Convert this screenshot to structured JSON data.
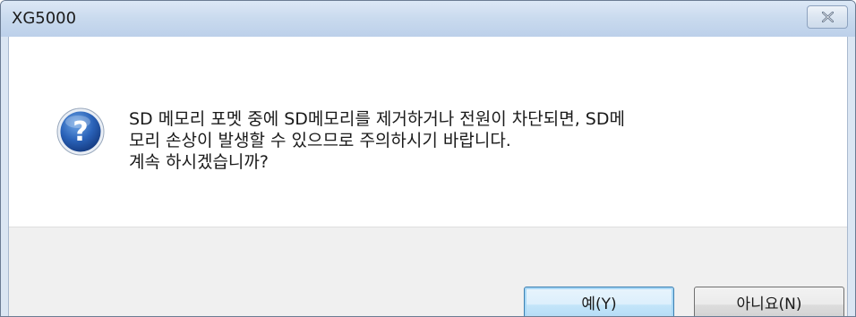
{
  "window": {
    "title": "XG5000",
    "close_icon": "close-icon"
  },
  "dialog": {
    "icon": "question-icon",
    "message_lines": [
      "SD 메모리 포멧 중에 SD메모리를 제거하거나 전원이 차단되면, SD메",
      "모리 손상이 발생할 수 있으므로 주의하시기 바랍니다.",
      "계속 하시겠습니까?"
    ]
  },
  "buttons": {
    "yes_label": "예(Y)",
    "no_label": "아니요(N)"
  },
  "colors": {
    "titlebar": "#c9daee",
    "footer": "#f0f0f0",
    "default_button_border": "#3c7fb1"
  }
}
